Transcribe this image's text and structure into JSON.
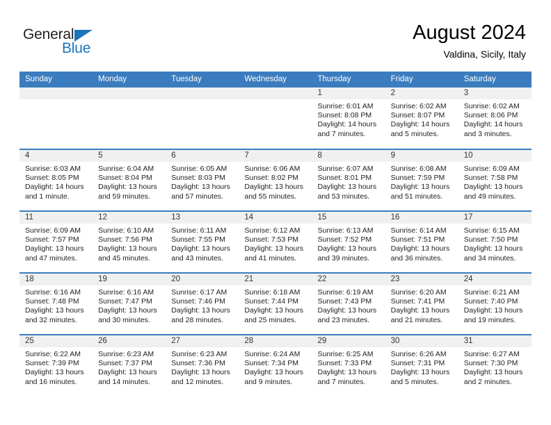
{
  "brand": {
    "name_part1": "General",
    "name_part2": "Blue",
    "accent_color": "#1b75bb",
    "triangle_icon": "brand-triangle-icon"
  },
  "header": {
    "title": "August 2024",
    "subtitle": "Valdina, Sicily, Italy"
  },
  "calendar": {
    "header_bg": "#3b7cbf",
    "daynum_bg": "#f0f0f0",
    "weekdays": [
      "Sunday",
      "Monday",
      "Tuesday",
      "Wednesday",
      "Thursday",
      "Friday",
      "Saturday"
    ],
    "weeks": [
      [
        {
          "day": "",
          "lines": []
        },
        {
          "day": "",
          "lines": []
        },
        {
          "day": "",
          "lines": []
        },
        {
          "day": "",
          "lines": []
        },
        {
          "day": "1",
          "lines": [
            "Sunrise: 6:01 AM",
            "Sunset: 8:08 PM",
            "Daylight: 14 hours",
            "and 7 minutes."
          ]
        },
        {
          "day": "2",
          "lines": [
            "Sunrise: 6:02 AM",
            "Sunset: 8:07 PM",
            "Daylight: 14 hours",
            "and 5 minutes."
          ]
        },
        {
          "day": "3",
          "lines": [
            "Sunrise: 6:02 AM",
            "Sunset: 8:06 PM",
            "Daylight: 14 hours",
            "and 3 minutes."
          ]
        }
      ],
      [
        {
          "day": "4",
          "lines": [
            "Sunrise: 6:03 AM",
            "Sunset: 8:05 PM",
            "Daylight: 14 hours",
            "and 1 minute."
          ]
        },
        {
          "day": "5",
          "lines": [
            "Sunrise: 6:04 AM",
            "Sunset: 8:04 PM",
            "Daylight: 13 hours",
            "and 59 minutes."
          ]
        },
        {
          "day": "6",
          "lines": [
            "Sunrise: 6:05 AM",
            "Sunset: 8:03 PM",
            "Daylight: 13 hours",
            "and 57 minutes."
          ]
        },
        {
          "day": "7",
          "lines": [
            "Sunrise: 6:06 AM",
            "Sunset: 8:02 PM",
            "Daylight: 13 hours",
            "and 55 minutes."
          ]
        },
        {
          "day": "8",
          "lines": [
            "Sunrise: 6:07 AM",
            "Sunset: 8:01 PM",
            "Daylight: 13 hours",
            "and 53 minutes."
          ]
        },
        {
          "day": "9",
          "lines": [
            "Sunrise: 6:08 AM",
            "Sunset: 7:59 PM",
            "Daylight: 13 hours",
            "and 51 minutes."
          ]
        },
        {
          "day": "10",
          "lines": [
            "Sunrise: 6:09 AM",
            "Sunset: 7:58 PM",
            "Daylight: 13 hours",
            "and 49 minutes."
          ]
        }
      ],
      [
        {
          "day": "11",
          "lines": [
            "Sunrise: 6:09 AM",
            "Sunset: 7:57 PM",
            "Daylight: 13 hours",
            "and 47 minutes."
          ]
        },
        {
          "day": "12",
          "lines": [
            "Sunrise: 6:10 AM",
            "Sunset: 7:56 PM",
            "Daylight: 13 hours",
            "and 45 minutes."
          ]
        },
        {
          "day": "13",
          "lines": [
            "Sunrise: 6:11 AM",
            "Sunset: 7:55 PM",
            "Daylight: 13 hours",
            "and 43 minutes."
          ]
        },
        {
          "day": "14",
          "lines": [
            "Sunrise: 6:12 AM",
            "Sunset: 7:53 PM",
            "Daylight: 13 hours",
            "and 41 minutes."
          ]
        },
        {
          "day": "15",
          "lines": [
            "Sunrise: 6:13 AM",
            "Sunset: 7:52 PM",
            "Daylight: 13 hours",
            "and 39 minutes."
          ]
        },
        {
          "day": "16",
          "lines": [
            "Sunrise: 6:14 AM",
            "Sunset: 7:51 PM",
            "Daylight: 13 hours",
            "and 36 minutes."
          ]
        },
        {
          "day": "17",
          "lines": [
            "Sunrise: 6:15 AM",
            "Sunset: 7:50 PM",
            "Daylight: 13 hours",
            "and 34 minutes."
          ]
        }
      ],
      [
        {
          "day": "18",
          "lines": [
            "Sunrise: 6:16 AM",
            "Sunset: 7:48 PM",
            "Daylight: 13 hours",
            "and 32 minutes."
          ]
        },
        {
          "day": "19",
          "lines": [
            "Sunrise: 6:16 AM",
            "Sunset: 7:47 PM",
            "Daylight: 13 hours",
            "and 30 minutes."
          ]
        },
        {
          "day": "20",
          "lines": [
            "Sunrise: 6:17 AM",
            "Sunset: 7:46 PM",
            "Daylight: 13 hours",
            "and 28 minutes."
          ]
        },
        {
          "day": "21",
          "lines": [
            "Sunrise: 6:18 AM",
            "Sunset: 7:44 PM",
            "Daylight: 13 hours",
            "and 25 minutes."
          ]
        },
        {
          "day": "22",
          "lines": [
            "Sunrise: 6:19 AM",
            "Sunset: 7:43 PM",
            "Daylight: 13 hours",
            "and 23 minutes."
          ]
        },
        {
          "day": "23",
          "lines": [
            "Sunrise: 6:20 AM",
            "Sunset: 7:41 PM",
            "Daylight: 13 hours",
            "and 21 minutes."
          ]
        },
        {
          "day": "24",
          "lines": [
            "Sunrise: 6:21 AM",
            "Sunset: 7:40 PM",
            "Daylight: 13 hours",
            "and 19 minutes."
          ]
        }
      ],
      [
        {
          "day": "25",
          "lines": [
            "Sunrise: 6:22 AM",
            "Sunset: 7:39 PM",
            "Daylight: 13 hours",
            "and 16 minutes."
          ]
        },
        {
          "day": "26",
          "lines": [
            "Sunrise: 6:23 AM",
            "Sunset: 7:37 PM",
            "Daylight: 13 hours",
            "and 14 minutes."
          ]
        },
        {
          "day": "27",
          "lines": [
            "Sunrise: 6:23 AM",
            "Sunset: 7:36 PM",
            "Daylight: 13 hours",
            "and 12 minutes."
          ]
        },
        {
          "day": "28",
          "lines": [
            "Sunrise: 6:24 AM",
            "Sunset: 7:34 PM",
            "Daylight: 13 hours",
            "and 9 minutes."
          ]
        },
        {
          "day": "29",
          "lines": [
            "Sunrise: 6:25 AM",
            "Sunset: 7:33 PM",
            "Daylight: 13 hours",
            "and 7 minutes."
          ]
        },
        {
          "day": "30",
          "lines": [
            "Sunrise: 6:26 AM",
            "Sunset: 7:31 PM",
            "Daylight: 13 hours",
            "and 5 minutes."
          ]
        },
        {
          "day": "31",
          "lines": [
            "Sunrise: 6:27 AM",
            "Sunset: 7:30 PM",
            "Daylight: 13 hours",
            "and 2 minutes."
          ]
        }
      ]
    ]
  }
}
